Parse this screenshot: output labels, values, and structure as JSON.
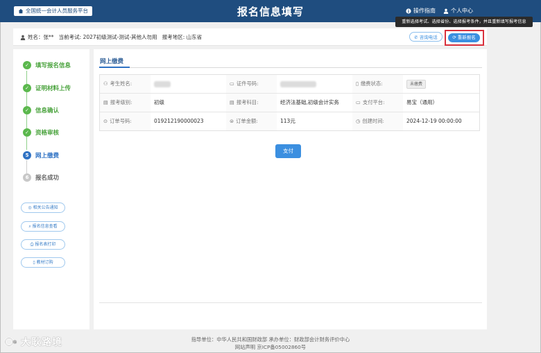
{
  "header": {
    "home_label": "全国统一会计人员服务平台",
    "title": "报名信息填写",
    "guide_label": "操作指南",
    "personal_label": "个人中心",
    "tooltip": "重新选择考试、选择省份、选择报考条件，并且重新填写报考信息"
  },
  "infobar": {
    "candidate_text": "姓名：张**   当前考试: 2027初级测试-测试-其他人勿用   报考地区: 山东省",
    "consult_label": "咨询电话",
    "redo_label": "重新报名"
  },
  "steps": [
    {
      "num": "✓",
      "label": "填写报名信息",
      "state": "done"
    },
    {
      "num": "✓",
      "label": "证明材料上传",
      "state": "done"
    },
    {
      "num": "✓",
      "label": "信息确认",
      "state": "done"
    },
    {
      "num": "✓",
      "label": "资格审核",
      "state": "done"
    },
    {
      "num": "5",
      "label": "网上缴费",
      "state": "active"
    },
    {
      "num": "6",
      "label": "报名成功",
      "state": "todo"
    }
  ],
  "side_links": [
    "相关公告通知",
    "报名信息查看",
    "报名表打印",
    "教材订购"
  ],
  "main": {
    "tab": "网上缴费",
    "rows": [
      [
        {
          "label": "考生姓名:",
          "value": "",
          "blurred": true
        },
        {
          "label": "证件号码:",
          "value": "",
          "blurred": true
        },
        {
          "label": "缴费状态:",
          "value": "未缴费",
          "badge": true
        }
      ],
      [
        {
          "label": "报考级别:",
          "value": "初级"
        },
        {
          "label": "报考科目:",
          "value": "经济法基础,初级会计实务"
        },
        {
          "label": "支付平台:",
          "value": "易宝（通用）"
        }
      ],
      [
        {
          "label": "订单号码:",
          "value": "019212190000023"
        },
        {
          "label": "订单金额:",
          "value": "113元"
        },
        {
          "label": "创建时间:",
          "value": "2024-12-19 00:00:00"
        }
      ]
    ],
    "pay_label": "支付"
  },
  "footer": {
    "line1": "指导单位：中华人民共和国财政部     承办单位：财政部会计财务评价中心",
    "line2": "网站声明     京ICP备05002860号"
  },
  "watermark": "大耿路境"
}
